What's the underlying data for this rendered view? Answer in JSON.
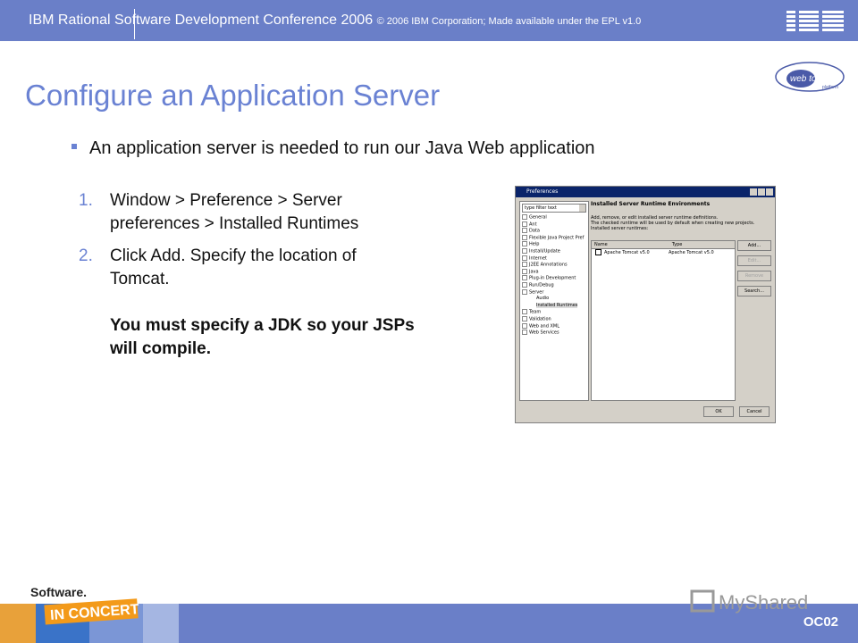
{
  "header": {
    "conference": "IBM Rational Software Development Conference 2006",
    "copyright": "© 2006 IBM Corporation; Made available under the EPL v1.0",
    "logo_text": "IBM"
  },
  "slide": {
    "title": "Configure an Application Server",
    "bullet": "An application server is needed to run our Java Web application",
    "steps": [
      {
        "num": "1.",
        "text": "Window > Preference > Server preferences > Installed Runtimes"
      },
      {
        "num": "2.",
        "text": "Click Add. Specify the location of Tomcat."
      }
    ],
    "note": "You must specify a JDK so your JSPs will compile."
  },
  "webtools_logo": {
    "line1": "web tools",
    "line2": "platform"
  },
  "preferences_window": {
    "title": "Preferences",
    "filter_text": "type filter text",
    "tree": [
      {
        "label": "General",
        "indent": false
      },
      {
        "label": "Ant",
        "indent": false
      },
      {
        "label": "Data",
        "indent": false
      },
      {
        "label": "Flexible Java Project Pref",
        "indent": false
      },
      {
        "label": "Help",
        "indent": false
      },
      {
        "label": "Install/Update",
        "indent": false
      },
      {
        "label": "Internet",
        "indent": false
      },
      {
        "label": "J2EE Annotations",
        "indent": false
      },
      {
        "label": "Java",
        "indent": false
      },
      {
        "label": "Plug-in Development",
        "indent": false
      },
      {
        "label": "Run/Debug",
        "indent": false
      },
      {
        "label": "Server",
        "indent": false
      },
      {
        "label": "Audio",
        "indent": true
      },
      {
        "label": "Installed Runtimes",
        "indent": true,
        "selected": true
      },
      {
        "label": "Team",
        "indent": false
      },
      {
        "label": "Validation",
        "indent": false
      },
      {
        "label": "Web and XML",
        "indent": false
      },
      {
        "label": "Web Services",
        "indent": false
      }
    ],
    "panel_title": "Installed Server Runtime Environments",
    "desc1": "Add, remove, or edit installed server runtime definitions.",
    "desc2": "The checked runtime will be used by default when creating new projects.",
    "desc3": "Installed server runtimes:",
    "col_name": "Name",
    "col_type": "Type",
    "row_name": "Apache Tomcat v5.0",
    "row_type": "Apache Tomcat v5.0",
    "btn_add": "Add...",
    "btn_edit": "Edit...",
    "btn_remove": "Remove",
    "btn_search": "Search...",
    "btn_ok": "OK",
    "btn_cancel": "Cancel"
  },
  "footer": {
    "code": "OC02",
    "software": "Software.",
    "inconcert": "IN CONCERT",
    "watermark": "MyShared"
  }
}
